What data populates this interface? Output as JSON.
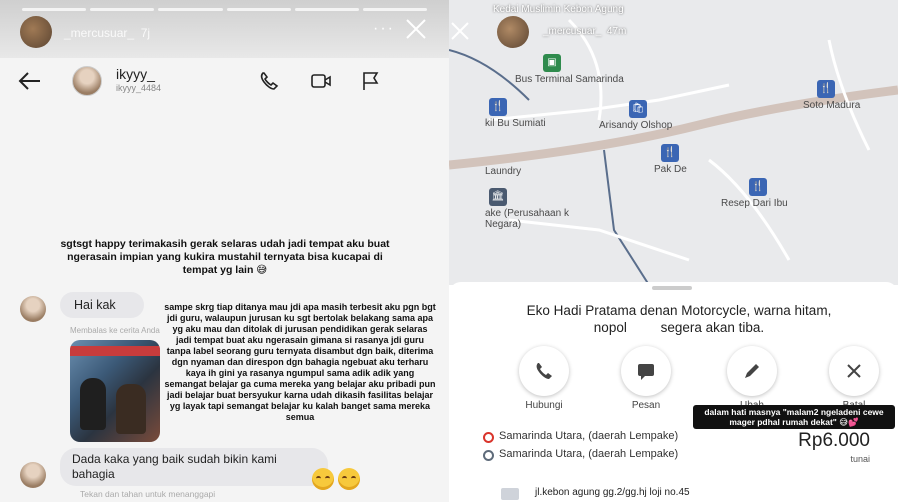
{
  "left_story": {
    "username": "_mercusuar_",
    "time": "7j",
    "dm": {
      "name": "ikyyy_",
      "handle": "ikyyy_4484",
      "story_note": "sgtsgt happy terimakasih gerak selaras udah jadi tempat aku buat ngerasain impian yang kukira mustahil ternyata bisa kucapai di tempat yg lain 😅",
      "msg1": "Hai kak",
      "reply_label": "Membalas ke cerita Anda",
      "long_text": "sampe skrg tiap ditanya mau jdi apa masih terbesit aku pgn bgt jdi guru, walaupun jurusan ku sgt bertolak belakang sama apa yg aku mau dan ditolak di jurusan pendidikan gerak selaras jadi tempat buat aku ngerasain gimana si rasanya jdi guru tanpa label seorang guru ternyata disambut dgn baik, diterima dgn nyaman dan direspon dgn bahagia ngebuat aku terharu kaya ih gini ya rasanya ngumpul sama adik adik yang semangat belajar ga cuma mereka yang belajar aku pribadi pun jadi belajar buat bersyukur karna udah dikasih fasilitas belajar yg layak tapi semangat belajar ku kalah banget sama mereka semua",
      "msg2": "Dada kaka yang baik sudah bikin kami bahagia",
      "tap_hint": "Tekan dan tahan untuk menanggapi"
    }
  },
  "right_story": {
    "username": "_mercusuar_",
    "time": "47m",
    "map_top_text": "Kedai Muslimin Kebon Agung",
    "map_labels": {
      "bus": "Bus Terminal Samarinda",
      "soto": "Soto Madura",
      "bu": "kil Bu Sumiati",
      "arisandy": "Arisandy Olshop",
      "laundry": "Laundry",
      "pakde": "Pak De",
      "resep": "Resep Dari Ibu",
      "perusahaan": "ake (Perusahaan k Negara)"
    },
    "driver_text_a": "Eko Hadi Pratama den",
    "driver_text_b": "an Motorcycle, warna hitam,",
    "driver_text_c": "nopol",
    "driver_text_d": "segera akan tiba.",
    "actions": [
      "Hubungi",
      "Pesan",
      "Ubah",
      "Batal"
    ],
    "caption": "dalam hati masnya \"malam2 ngeladeni cewe mager pdhal rumah dekat\" 😅💕",
    "origin": "Samarinda Utara, (daerah Lempake)",
    "destination": "Samarinda Utara, (daerah Lempake)",
    "price": "Rp6.000",
    "payment": "tunai",
    "address": "jl.kebon agung gg.2/gg.hj loji no.45",
    "colors": {
      "origin": "#d9342b",
      "destination": "#5e6b7a",
      "poi": "#3b66b4",
      "road": "#d2c3bb"
    }
  }
}
